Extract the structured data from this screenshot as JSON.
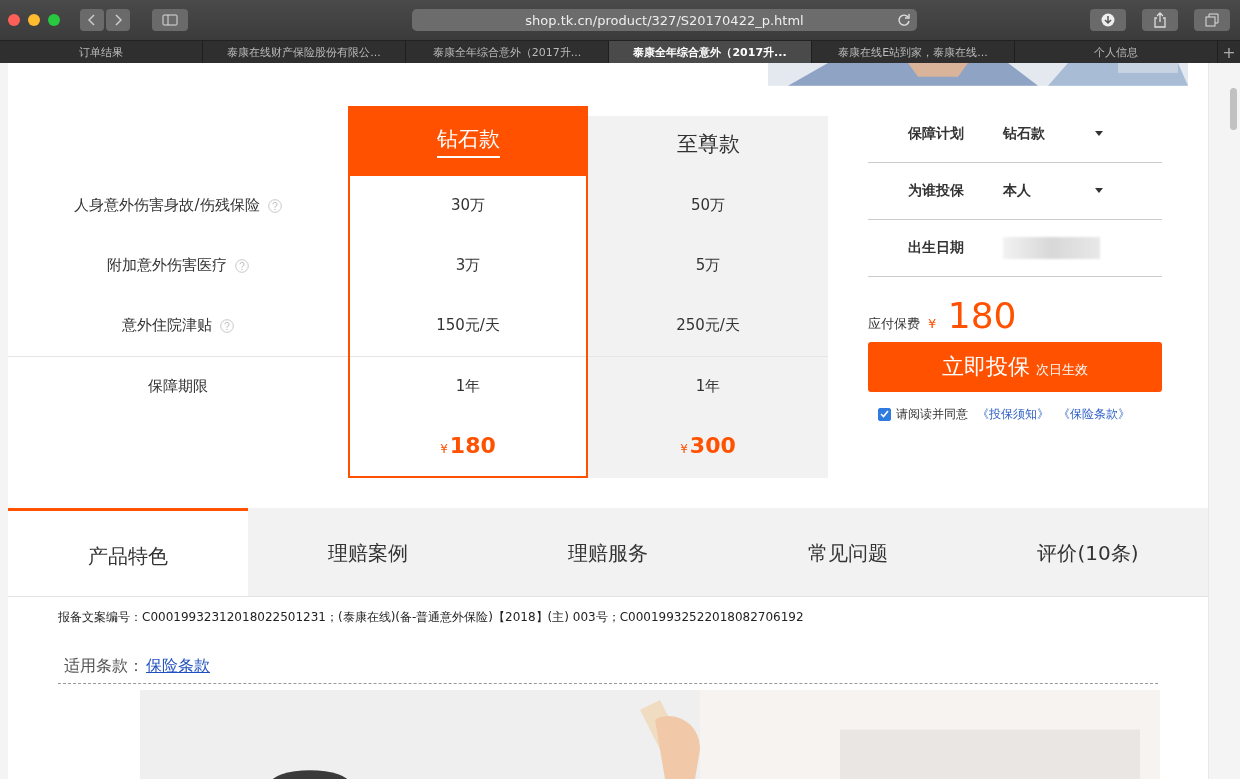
{
  "browser": {
    "url": "shop.tk.cn/product/327/S20170422_p.html",
    "tabs": [
      {
        "label": "订单结果",
        "selected": false
      },
      {
        "label": "泰康在线财产保险股份有限公...",
        "selected": false
      },
      {
        "label": "泰康全年综合意外（2017升...",
        "selected": false
      },
      {
        "label": "泰康全年综合意外（2017升...",
        "selected": true
      },
      {
        "label": "泰康在线E站到家，泰康在线...",
        "selected": false
      },
      {
        "label": "个人信息",
        "selected": false
      }
    ],
    "new_tab": "+"
  },
  "features": [
    {
      "label": "人身意外伤害身故/伤残保险",
      "help": true
    },
    {
      "label": "附加意外伤害医疗",
      "help": true
    },
    {
      "label": "意外住院津贴",
      "help": true
    },
    {
      "label": "保障期限",
      "help": false
    }
  ],
  "plans": [
    {
      "name": "钻石款",
      "selected": true,
      "values": [
        "30万",
        "3万",
        "150元/天",
        "1年"
      ],
      "currency": "¥",
      "price": "180"
    },
    {
      "name": "至尊款",
      "selected": false,
      "values": [
        "50万",
        "5万",
        "250元/天",
        "1年"
      ],
      "currency": "¥",
      "price": "300"
    }
  ],
  "form": {
    "fields": [
      {
        "label": "保障计划",
        "kind": "select",
        "value": "钻石款"
      },
      {
        "label": "为谁投保",
        "kind": "select",
        "value": "本人"
      },
      {
        "label": "出生日期",
        "kind": "blurred"
      }
    ],
    "premium_label": "应付保费",
    "currency": "¥",
    "premium": "180",
    "buy_button": {
      "label": "立即投保",
      "note": "次日生效"
    },
    "agree": {
      "checked": true,
      "text": "请阅读并同意",
      "links": [
        "《投保须知》",
        "《保险条款》"
      ]
    }
  },
  "detail_tabs": [
    {
      "label": "产品特色",
      "selected": true
    },
    {
      "label": "理赔案例",
      "selected": false
    },
    {
      "label": "理赔服务",
      "selected": false
    },
    {
      "label": "常见问题",
      "selected": false
    },
    {
      "label": "评价(10条)",
      "selected": false
    }
  ],
  "filing_text": "报备文案编号：C00019932312018022501231；(泰康在线)(备-普通意外保险)【2018】(主) 003号；C00019932522018082706192",
  "clause": {
    "label": "适用条款：",
    "link": "保险条款"
  }
}
